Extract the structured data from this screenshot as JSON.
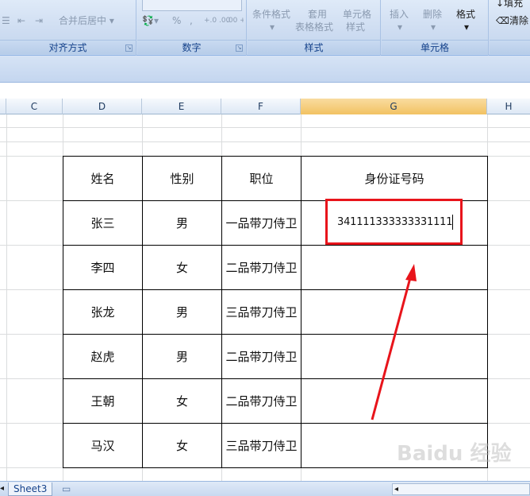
{
  "ribbon": {
    "groups": [
      {
        "title": "对齐方式"
      },
      {
        "title": "数字"
      },
      {
        "title": "样式"
      },
      {
        "title": "单元格"
      }
    ],
    "merge_center_label": "合并后居中",
    "percent_label": "%",
    "comma_label": ",",
    "increase_decimal_label": "+.0 .00",
    "decrease_decimal_label": ".00 +.0",
    "conditional_format_label": "条件格式",
    "table_format_label_1": "套用",
    "table_format_label_2": "表格格式",
    "cell_style_label_1": "单元格",
    "cell_style_label_2": "样式",
    "insert_label": "插入",
    "delete_label": "删除",
    "format_label": "格式",
    "fill_label": "填充",
    "clear_label": "清除"
  },
  "columns": [
    "C",
    "D",
    "E",
    "F",
    "G",
    "H"
  ],
  "active_column": "G",
  "table": {
    "headers": [
      "姓名",
      "性别",
      "职位",
      "身份证号码"
    ],
    "rows": [
      [
        "张三",
        "男",
        "一品带刀侍卫",
        "341111333333331111"
      ],
      [
        "李四",
        "女",
        "二品带刀侍卫",
        ""
      ],
      [
        "张龙",
        "男",
        "三品带刀侍卫",
        ""
      ],
      [
        "赵虎",
        "男",
        "二品带刀侍卫",
        ""
      ],
      [
        "王朝",
        "女",
        "二品带刀侍卫",
        ""
      ],
      [
        "马汉",
        "女",
        "三品带刀侍卫",
        ""
      ]
    ]
  },
  "sheet_tabs": [
    "Sheet3"
  ],
  "watermark": "Baidu 经验",
  "colors": {
    "highlight": "#e8141b",
    "active_column_header": "#f2c262",
    "ribbon_title": "#15428b"
  }
}
